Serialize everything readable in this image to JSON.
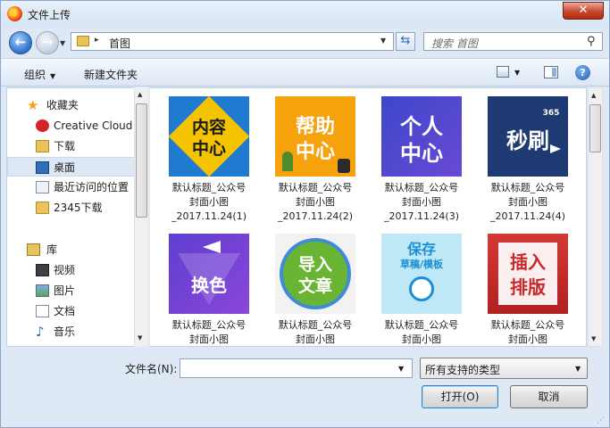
{
  "window": {
    "title": "文件上传",
    "close_glyph": "✕"
  },
  "address": {
    "back_glyph": "←",
    "forward_glyph": "→",
    "separator": "▸",
    "path": "首图",
    "dropdown_glyph": "▼",
    "refresh_glyph": "⇆"
  },
  "search": {
    "placeholder": "搜索 首图",
    "icon_glyph": "⚲"
  },
  "toolbar": {
    "organize_label": "组织",
    "organize_arrow": "▼",
    "new_folder_label": "新建文件夹",
    "views_arrow": "▼",
    "help_glyph": "?"
  },
  "nav": {
    "favorites": [
      {
        "label": "收藏夹",
        "icon": "star-icon"
      },
      {
        "label": "Creative Cloud",
        "icon": "creative-cloud-icon"
      },
      {
        "label": "下载",
        "icon": "downloads-folder-icon"
      },
      {
        "label": "桌面",
        "icon": "desktop-icon",
        "selected": true
      },
      {
        "label": "最近访问的位置",
        "icon": "recent-places-icon"
      },
      {
        "label": "2345下载",
        "icon": "folder-icon"
      }
    ],
    "libraries": [
      {
        "label": "库",
        "icon": "library-icon"
      },
      {
        "label": "视频",
        "icon": "video-icon"
      },
      {
        "label": "图片",
        "icon": "pictures-icon"
      },
      {
        "label": "文档",
        "icon": "documents-icon"
      },
      {
        "label": "音乐",
        "icon": "music-icon"
      }
    ],
    "star_glyph": "★",
    "music_glyph": "♪"
  },
  "scroll": {
    "up_glyph": "▲",
    "down_glyph": "▼"
  },
  "files": [
    {
      "line1": "默认标题_公众号",
      "line2": "封面小图",
      "line3": "_2017.11.24(1)",
      "image_text_1": "内容",
      "image_text_2": "中心",
      "bg": "#1f7ad0",
      "accent": "#f5c400"
    },
    {
      "line1": "默认标题_公众号",
      "line2": "封面小图",
      "line3": "_2017.11.24(2)",
      "image_text_1": "帮助",
      "image_text_2": "中心",
      "bg": "#f5a20d",
      "accent": "#ffffff"
    },
    {
      "line1": "默认标题_公众号",
      "line2": "封面小图",
      "line3": "_2017.11.24(3)",
      "image_text_1": "个人",
      "image_text_2": "中心",
      "bg": "#4a58d8",
      "accent": "#ffffff"
    },
    {
      "line1": "默认标题_公众号",
      "line2": "封面小图",
      "line3": "_2017.11.24(4)",
      "image_text_1": "秒刷",
      "image_text_2": "365",
      "bg": "#1d3a73",
      "accent": "#ffffff"
    },
    {
      "line1": "默认标题_公众号",
      "line2": "封面小图",
      "line3": "",
      "image_text_1": "换色",
      "image_text_2": "",
      "bg": "#6d3fd3",
      "accent": "#ffffff"
    },
    {
      "line1": "默认标题_公众号",
      "line2": "封面小图",
      "line3": "",
      "image_text_1": "导入",
      "image_text_2": "文章",
      "bg": "#f2f2f2",
      "accent": "#69b533"
    },
    {
      "line1": "默认标题_公众号",
      "line2": "封面小图",
      "line3": "",
      "image_text_1": "保存",
      "image_text_2": "草稿/模板",
      "bg": "#bfe8f7",
      "accent": "#1a8fd6"
    },
    {
      "line1": "默认标题_公众号",
      "line2": "封面小图",
      "line3": "",
      "image_text_1": "插入",
      "image_text_2": "排版",
      "bg": "#c8282a",
      "accent": "#ffffff"
    }
  ],
  "bottom": {
    "filename_label": "文件名(N):",
    "filename_value": "",
    "filter_value": "所有支持的类型",
    "dropdown_glyph": "▼",
    "open_label": "打开(O)",
    "cancel_label": "取消",
    "grip_glyph": "⋰"
  }
}
